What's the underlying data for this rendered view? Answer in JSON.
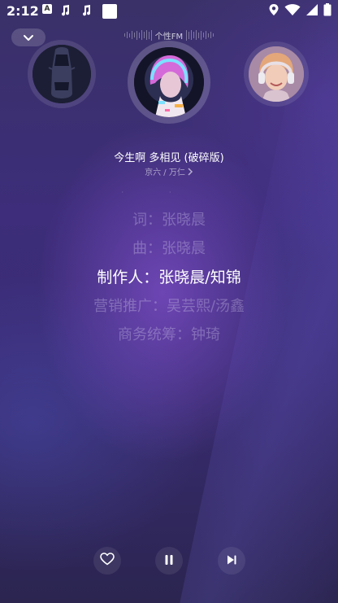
{
  "status_bar": {
    "time": "2:12",
    "icons": [
      "app-a-icon",
      "music-note-icon",
      "music-note-icon",
      "white-square-icon",
      "location-icon",
      "wifi-icon",
      "signal-icon",
      "battery-icon"
    ]
  },
  "header": {
    "fm_label": "个性FM"
  },
  "covers": {
    "left": "car-cover",
    "center": "neon-girl-cover",
    "right": "headphone-girl-cover"
  },
  "song": {
    "title": "今生啊 多相见 (破碎版)",
    "artist": "京六 / 万仁"
  },
  "lyrics": [
    "词：张晓晨",
    "曲：张晓晨",
    "制作人：张晓晨/知锦",
    "营销推广：吴芸熙/汤鑫",
    "商务统筹：钟琦"
  ],
  "lyrics_active_index": 2,
  "controls": {
    "like": "heart-icon",
    "play_pause": "pause-icon",
    "next": "skip-next-icon"
  },
  "colors": {
    "background": "#3a2c74",
    "accent_glow": "#9a5ae6",
    "lyric_inactive": "#c8bee6",
    "lyric_active": "#ffffff"
  }
}
